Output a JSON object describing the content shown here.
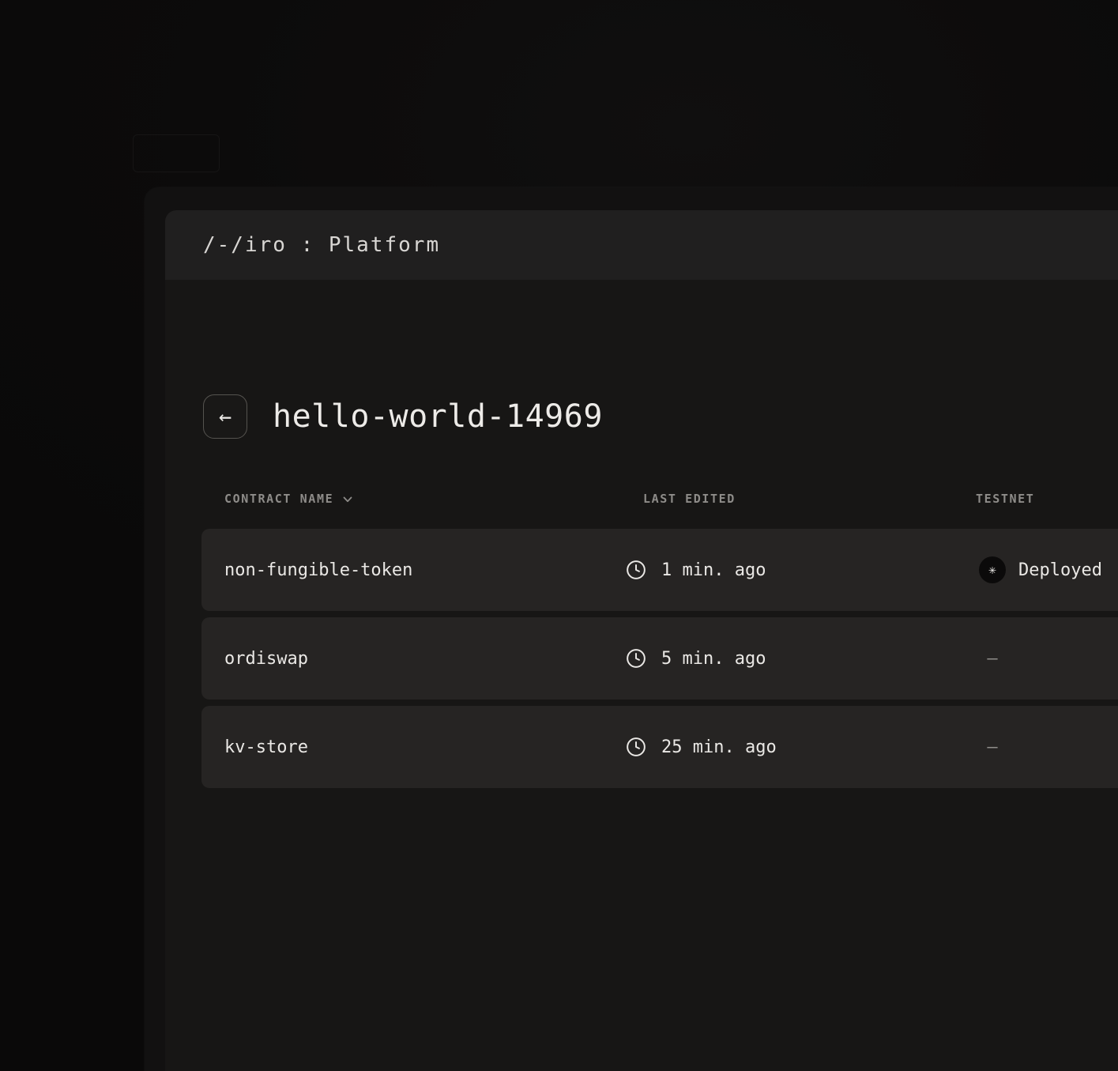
{
  "app": {
    "titlebar": "/-/iro : Platform"
  },
  "page": {
    "back_icon": "←",
    "title": "hello-world-14969"
  },
  "table": {
    "headers": {
      "contract_name": "CONTRACT NAME",
      "last_edited": "LAST EDITED",
      "testnet": "TESTNET"
    },
    "rows": [
      {
        "name": "non-fungible-token",
        "last_edited": "1 min. ago",
        "testnet_status": "Deployed"
      },
      {
        "name": "ordiswap",
        "last_edited": "5 min. ago",
        "testnet_status": "–"
      },
      {
        "name": "kv-store",
        "last_edited": "25 min. ago",
        "testnet_status": "–"
      }
    ]
  },
  "icons": {
    "stacks_glyph": "✳"
  },
  "colors": {
    "background": "#0c0b0b",
    "window": "#121111",
    "surface": "#171615",
    "titlebar": "#201f1f",
    "row": "#262423",
    "text_primary": "#eae8e5",
    "text_muted": "#8e8c89"
  }
}
